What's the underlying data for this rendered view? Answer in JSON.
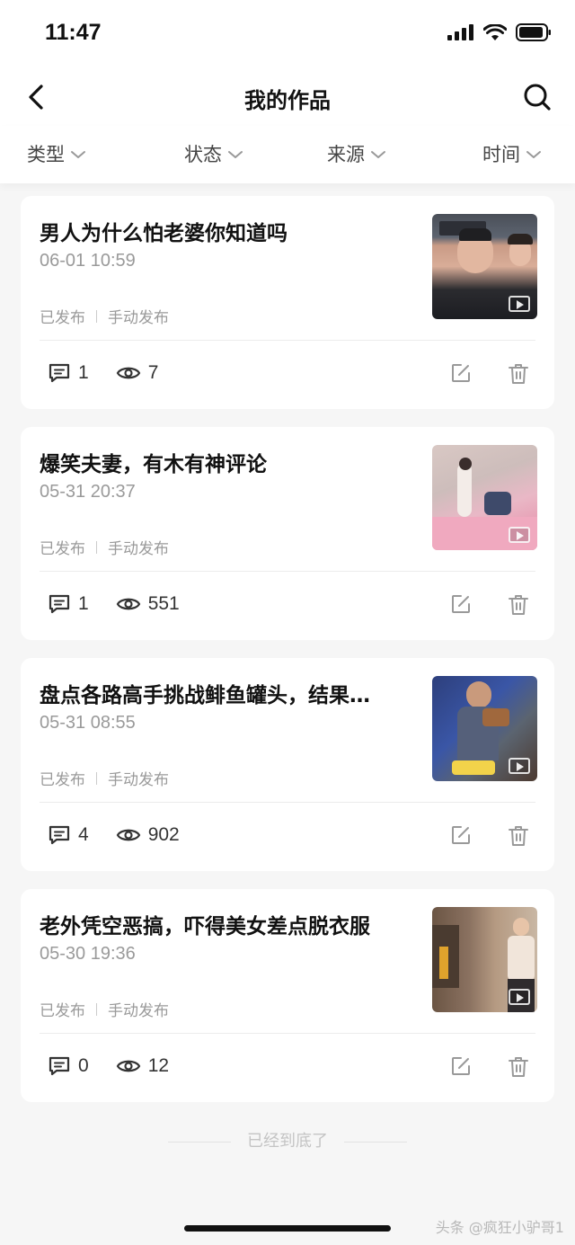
{
  "status_bar": {
    "time": "11:47"
  },
  "header": {
    "title": "我的作品"
  },
  "filters": [
    {
      "label": "类型"
    },
    {
      "label": "状态"
    },
    {
      "label": "来源"
    },
    {
      "label": "时间"
    }
  ],
  "works": [
    {
      "title": "男人为什么怕老婆你知道吗",
      "date": "06-01 10:59",
      "status": "已发布",
      "source": "手动发布",
      "comments": "1",
      "views": "7"
    },
    {
      "title": "爆笑夫妻，有木有神评论",
      "date": "05-31 20:37",
      "status": "已发布",
      "source": "手动发布",
      "comments": "1",
      "views": "551"
    },
    {
      "title": "盘点各路高手挑战鲱鱼罐头，结果…",
      "date": "05-31 08:55",
      "status": "已发布",
      "source": "手动发布",
      "comments": "4",
      "views": "902"
    },
    {
      "title": "老外凭空恶搞，吓得美女差点脱衣服",
      "date": "05-30 19:36",
      "status": "已发布",
      "source": "手动发布",
      "comments": "0",
      "views": "12"
    }
  ],
  "footer": {
    "end_text": "已经到底了"
  },
  "watermark": "头条 @疯狂小驴哥1",
  "icons": {
    "back": "chevron-left-icon",
    "search": "search-icon",
    "filter_arrow": "chevron-down-icon",
    "comment": "comment-icon",
    "view": "eye-icon",
    "edit": "edit-icon",
    "delete": "trash-icon"
  },
  "colors": {
    "text": "#111111",
    "muted": "#9a9a9a",
    "background": "#f6f6f6",
    "card": "#ffffff"
  }
}
